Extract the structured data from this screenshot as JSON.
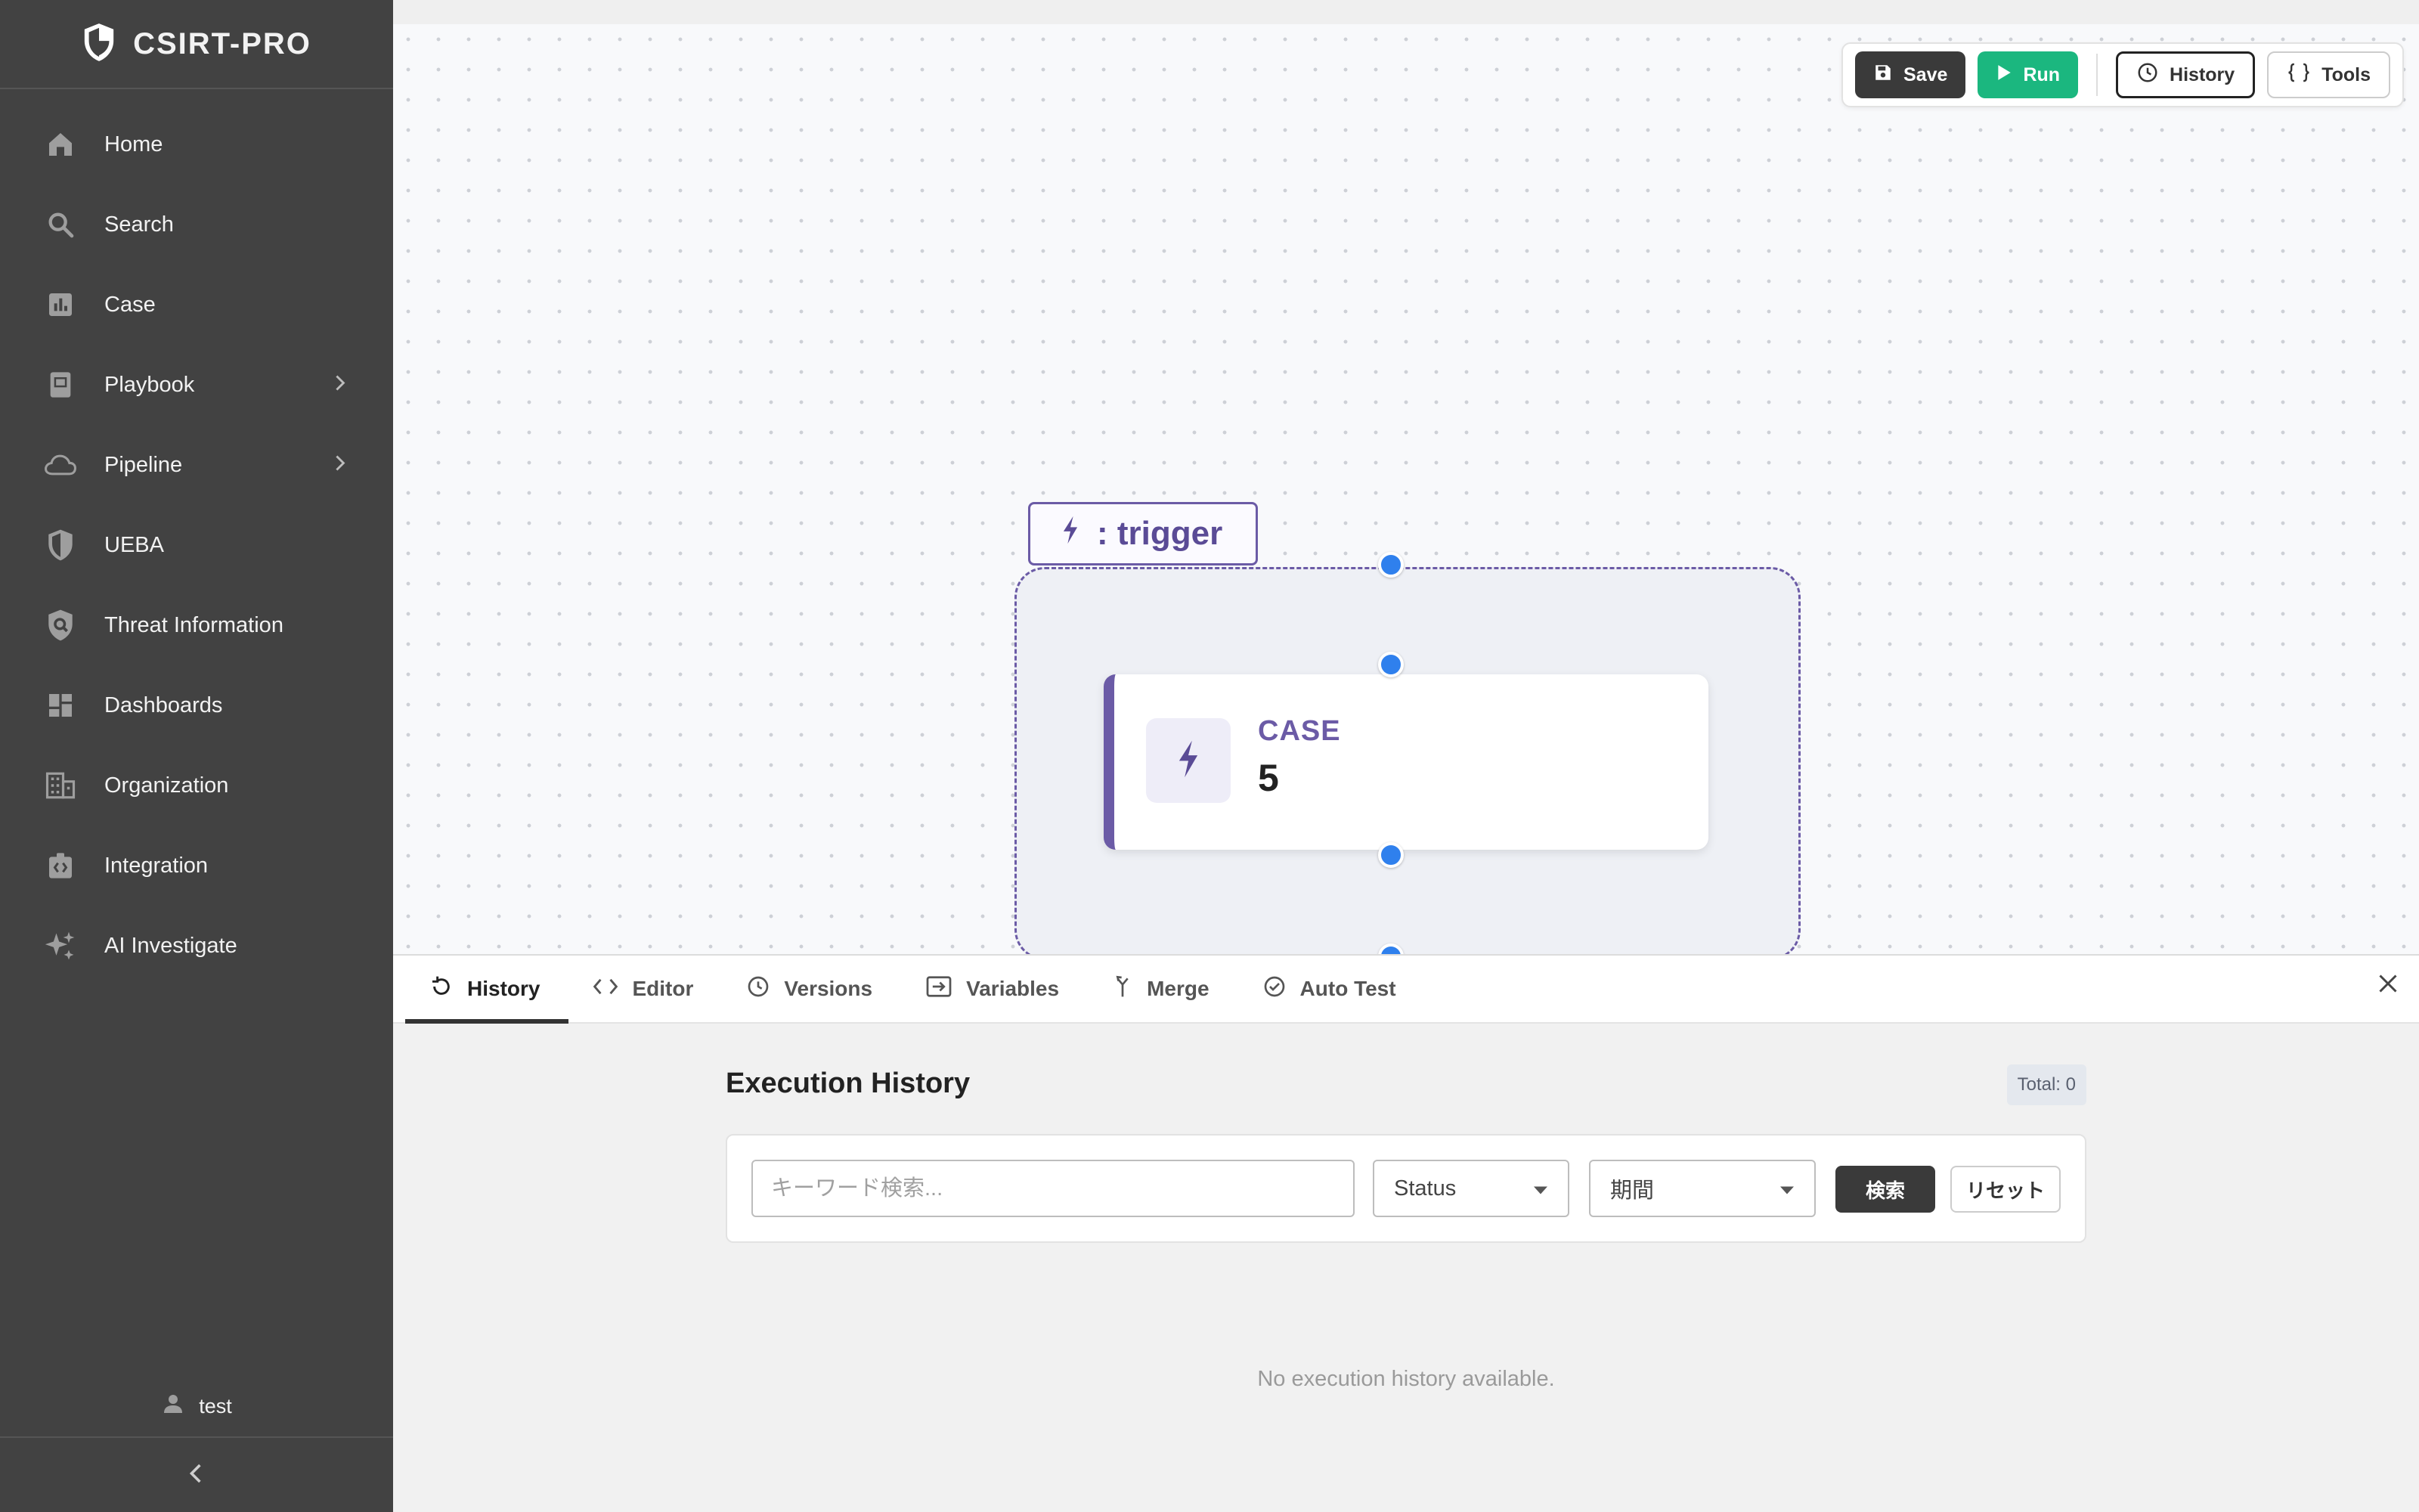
{
  "app": {
    "brand": "CSIRT-PRO"
  },
  "sidebar": {
    "items": [
      {
        "label": "Home",
        "icon": "home-icon"
      },
      {
        "label": "Search",
        "icon": "search-icon"
      },
      {
        "label": "Case",
        "icon": "bar-chart-icon"
      },
      {
        "label": "Playbook",
        "icon": "book-icon",
        "expandable": true
      },
      {
        "label": "Pipeline",
        "icon": "cloud-icon",
        "expandable": true
      },
      {
        "label": "UEBA",
        "icon": "shield-icon"
      },
      {
        "label": "Threat Information",
        "icon": "shield-search-icon"
      },
      {
        "label": "Dashboards",
        "icon": "dashboard-icon"
      },
      {
        "label": "Organization",
        "icon": "building-icon"
      },
      {
        "label": "Integration",
        "icon": "integration-icon"
      },
      {
        "label": "AI Investigate",
        "icon": "sparkles-icon"
      }
    ],
    "user": "test"
  },
  "toolbar": {
    "save_label": "Save",
    "run_label": "Run",
    "history_label": "History",
    "tools_label": "Tools"
  },
  "canvas": {
    "trigger_label": ": trigger",
    "node": {
      "type": "CASE",
      "value": "5"
    }
  },
  "panel": {
    "tabs": [
      {
        "label": "History",
        "icon": "history-icon",
        "active": true
      },
      {
        "label": "Editor",
        "icon": "code-icon"
      },
      {
        "label": "Versions",
        "icon": "clock-icon"
      },
      {
        "label": "Variables",
        "icon": "variables-icon"
      },
      {
        "label": "Merge",
        "icon": "merge-icon"
      },
      {
        "label": "Auto Test",
        "icon": "check-circle-icon"
      }
    ],
    "title": "Execution History",
    "total": "Total: 0",
    "search_placeholder": "キーワード検索...",
    "status_select": "Status",
    "period_select": "期間",
    "search_button": "検索",
    "reset_button": "リセット",
    "empty_message": "No execution history available."
  },
  "colors": {
    "sidebar_bg": "#424242",
    "accent_purple": "#6b5ba6",
    "run_green": "#1bb77f",
    "port_blue": "#2f80ed"
  }
}
